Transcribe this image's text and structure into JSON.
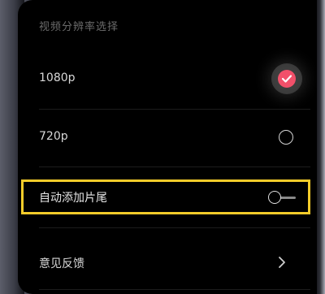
{
  "resolution_section": {
    "title": "视频分辨率选择",
    "options": [
      {
        "label": "1080p",
        "selected": true
      },
      {
        "label": "720p",
        "selected": false
      }
    ],
    "accent_color": "#f2506a"
  },
  "end_credits": {
    "label": "自动添加片尾",
    "enabled": false,
    "highlight_color": "#f4cc2a"
  },
  "feedback": {
    "label": "意见反馈",
    "icon": "chevron-right-icon"
  }
}
